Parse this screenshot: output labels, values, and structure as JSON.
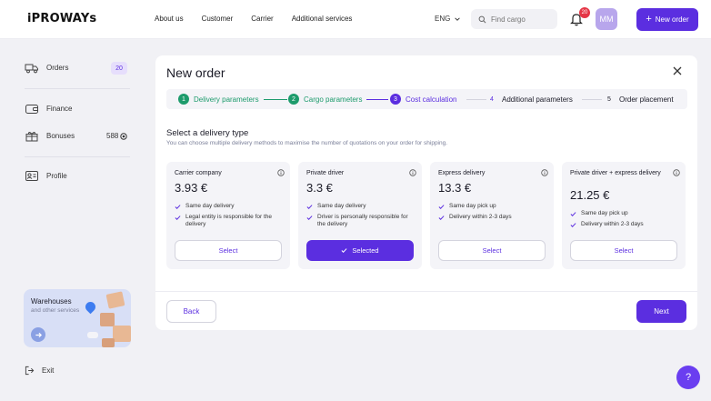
{
  "header": {
    "logo": "iPROWAYs",
    "nav": [
      "About us",
      "Customer",
      "Carrier",
      "Additional services"
    ],
    "lang": "ENG",
    "search_placeholder": "Find cargo",
    "notifications_count": "20",
    "avatar_initials": "MM",
    "new_order_label": "New order"
  },
  "sidebar": {
    "orders_label": "Orders",
    "orders_count": "20",
    "finance_label": "Finance",
    "bonuses_label": "Bonuses",
    "bonuses_value": "588",
    "profile_label": "Profile",
    "promo_title": "Warehouses",
    "promo_subtitle": "and other services",
    "exit_label": "Exit"
  },
  "card": {
    "title": "New order",
    "steps": [
      {
        "num": "1",
        "label": "Delivery parameters"
      },
      {
        "num": "2",
        "label": "Cargo parameters"
      },
      {
        "num": "3",
        "label": "Cost calculation"
      },
      {
        "num": "4",
        "label": "Additional parameters"
      },
      {
        "num": "5",
        "label": "Order placement"
      }
    ],
    "section_title": "Select a delivery type",
    "section_subtitle": "You can choose multiple delivery methods to maximise the number of quotations on your order for shipping.",
    "options": [
      {
        "name": "Carrier company",
        "price": "3.93 €",
        "features": [
          "Same day delivery",
          "Legal entity is responsible for the delivery"
        ],
        "button": "Select"
      },
      {
        "name": "Private driver",
        "price": "3.3 €",
        "features": [
          "Same day delivery",
          "Driver is personally responsible for the delivery"
        ],
        "button": "Selected"
      },
      {
        "name": "Express delivery",
        "price": "13.3 €",
        "features": [
          "Same day pick up",
          "Delivery within 2-3 days"
        ],
        "button": "Select"
      },
      {
        "name": "Private driver + express delivery",
        "price": "21.25 €",
        "features": [
          "Same day pick up",
          "Delivery within 2-3 days"
        ],
        "button": "Select"
      }
    ],
    "back_label": "Back",
    "next_label": "Next"
  },
  "help_label": "?",
  "colors": {
    "accent": "#5b2ee0",
    "done": "#1d9b6c",
    "background": "#f1f1f5"
  }
}
